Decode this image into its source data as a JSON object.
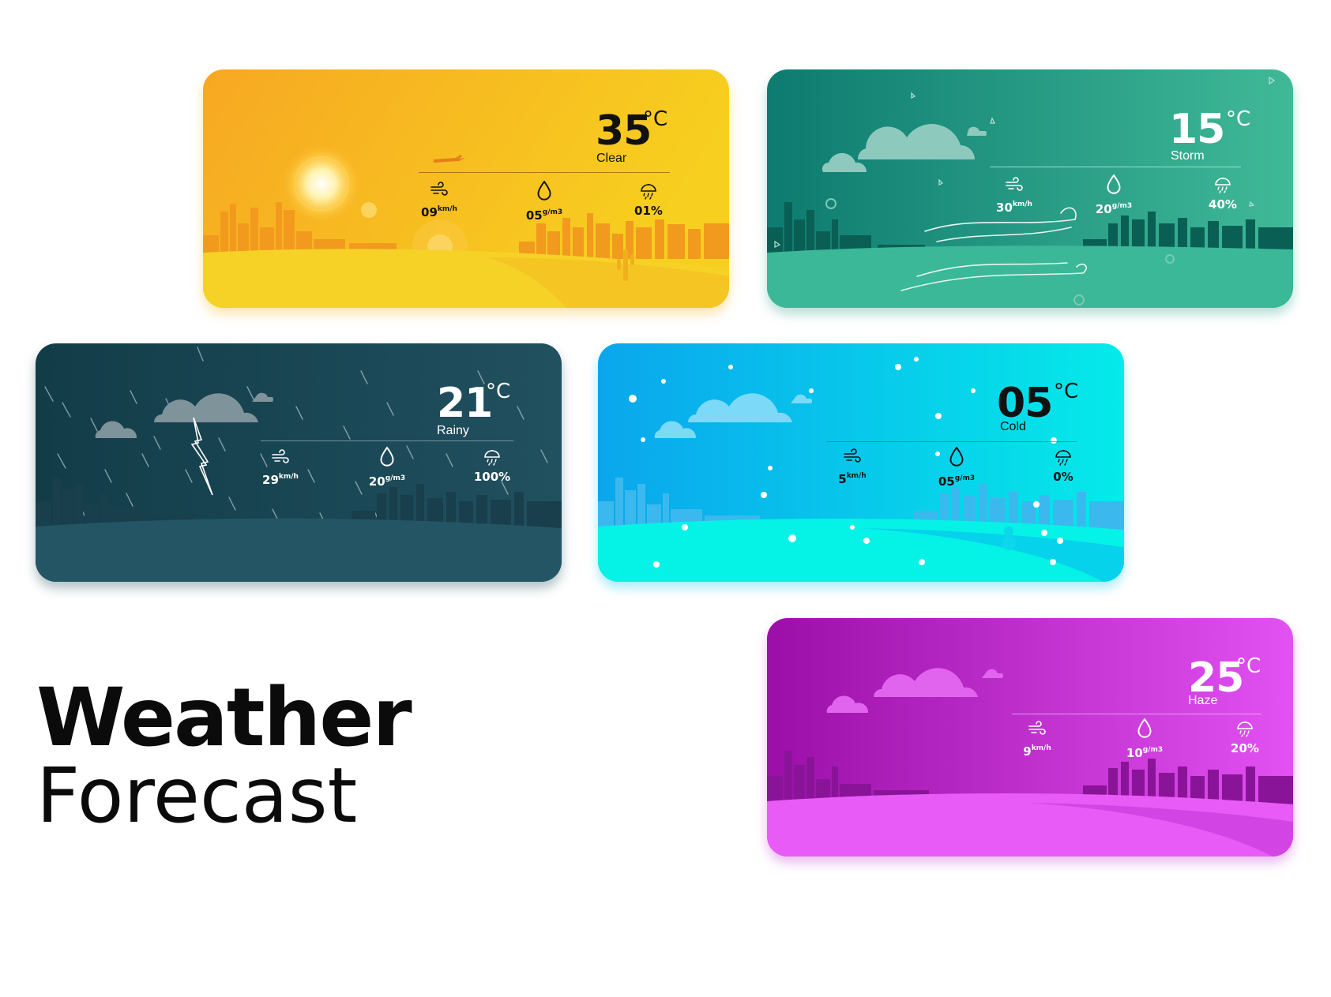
{
  "title": {
    "line1": "Weather",
    "line2": "Forecast"
  },
  "cards": [
    {
      "id": "clear",
      "temperature": "35",
      "unit": "°C",
      "condition": "Clear",
      "stats": [
        {
          "icon": "wind-icon",
          "value": "09",
          "unit": "km/h"
        },
        {
          "icon": "humidity-icon",
          "value": "05",
          "unit": "g/m3"
        },
        {
          "icon": "rain-chance-icon",
          "value": "01%",
          "unit": ""
        }
      ],
      "colors": {
        "text": "#111111",
        "accent": "#f6b417"
      }
    },
    {
      "id": "storm",
      "temperature": "15",
      "unit": "°C",
      "condition": "Storm",
      "stats": [
        {
          "icon": "wind-icon",
          "value": "30",
          "unit": "km/h"
        },
        {
          "icon": "humidity-icon",
          "value": "20",
          "unit": "g/m3"
        },
        {
          "icon": "rain-chance-icon",
          "value": "40%",
          "unit": ""
        }
      ],
      "colors": {
        "text": "#ffffff",
        "accent": "#2ea48a"
      }
    },
    {
      "id": "rainy",
      "temperature": "21",
      "unit": "°C",
      "condition": "Rainy",
      "stats": [
        {
          "icon": "wind-icon",
          "value": "29",
          "unit": "km/h"
        },
        {
          "icon": "humidity-icon",
          "value": "20",
          "unit": "g/m3"
        },
        {
          "icon": "rain-chance-icon",
          "value": "100%",
          "unit": ""
        }
      ],
      "colors": {
        "text": "#ffffff",
        "accent": "#1e4b5a"
      }
    },
    {
      "id": "cold",
      "temperature": "05",
      "unit": "°C",
      "condition": "Cold",
      "stats": [
        {
          "icon": "wind-icon",
          "value": "5",
          "unit": "km/h"
        },
        {
          "icon": "humidity-icon",
          "value": "05",
          "unit": "g/m3"
        },
        {
          "icon": "rain-chance-icon",
          "value": "0%",
          "unit": ""
        }
      ],
      "colors": {
        "text": "#111111",
        "accent": "#05c9ef"
      }
    },
    {
      "id": "haze",
      "temperature": "25",
      "unit": "°C",
      "condition": "Haze",
      "stats": [
        {
          "icon": "wind-icon",
          "value": "9",
          "unit": "km/h"
        },
        {
          "icon": "humidity-icon",
          "value": "10",
          "unit": "g/m3"
        },
        {
          "icon": "rain-chance-icon",
          "value": "20%",
          "unit": ""
        }
      ],
      "colors": {
        "text": "#ffffff",
        "accent": "#c43ed8"
      }
    }
  ]
}
